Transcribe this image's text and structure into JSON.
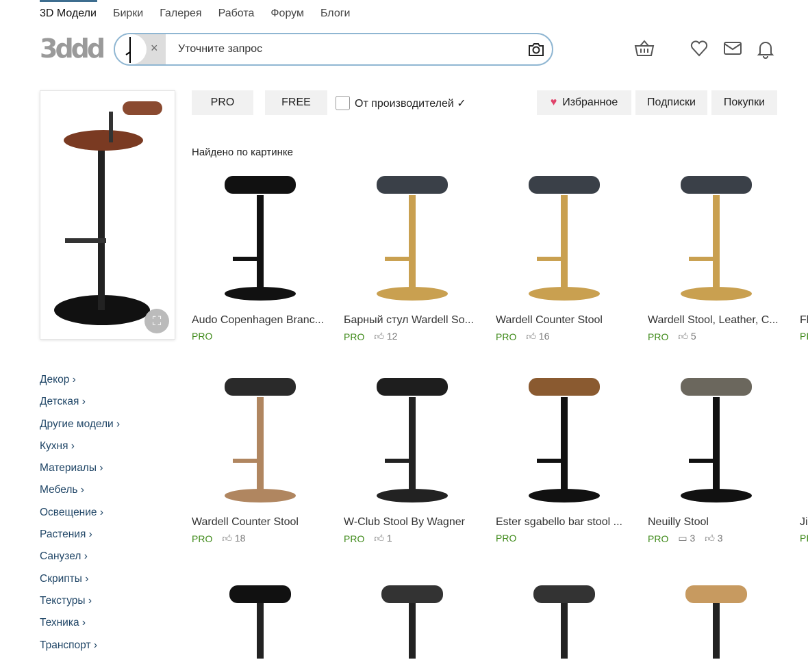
{
  "nav": [
    "3D Модели",
    "Бирки",
    "Галерея",
    "Работа",
    "Форум",
    "Блоги"
  ],
  "logo": "3ddd",
  "search": {
    "placeholder": "Уточните запрос",
    "clear": "×"
  },
  "filters": {
    "pro": "PRO",
    "free": "FREE",
    "manufacturers": "От производителей",
    "favorites": "Избранное",
    "subscriptions": "Подписки",
    "purchases": "Покупки"
  },
  "found_label": "Найдено по картинке",
  "cards": [
    {
      "title": "Audo Copenhagen Branc...",
      "badge": "PRO",
      "likes": null,
      "comments": null
    },
    {
      "title": "Барный стул Wardell So...",
      "badge": "PRO",
      "likes": "12",
      "comments": null
    },
    {
      "title": "Wardell Counter Stool",
      "badge": "PRO",
      "likes": "16",
      "comments": null
    },
    {
      "title": "Wardell Stool, Leather, C...",
      "badge": "PRO",
      "likes": "5",
      "comments": null
    },
    {
      "title": "Fl",
      "badge": "PI",
      "likes": null,
      "comments": null
    },
    {
      "title": "Wardell Counter Stool",
      "badge": "PRO",
      "likes": "18",
      "comments": null
    },
    {
      "title": "W-Club Stool By Wagner",
      "badge": "PRO",
      "likes": "1",
      "comments": null
    },
    {
      "title": "Ester sgabello bar stool ...",
      "badge": "PRO",
      "likes": null,
      "comments": null
    },
    {
      "title": "Neuilly Stool",
      "badge": "PRO",
      "likes": "3",
      "comments": "3"
    },
    {
      "title": "Ji",
      "badge": "PI",
      "likes": null,
      "comments": null
    }
  ],
  "categories": [
    "Декор",
    "Детская",
    "Другие модели",
    "Кухня",
    "Материалы",
    "Мебель",
    "Освещение",
    "Растения",
    "Санузел",
    "Скрипты",
    "Текстуры",
    "Техника",
    "Транспорт"
  ]
}
